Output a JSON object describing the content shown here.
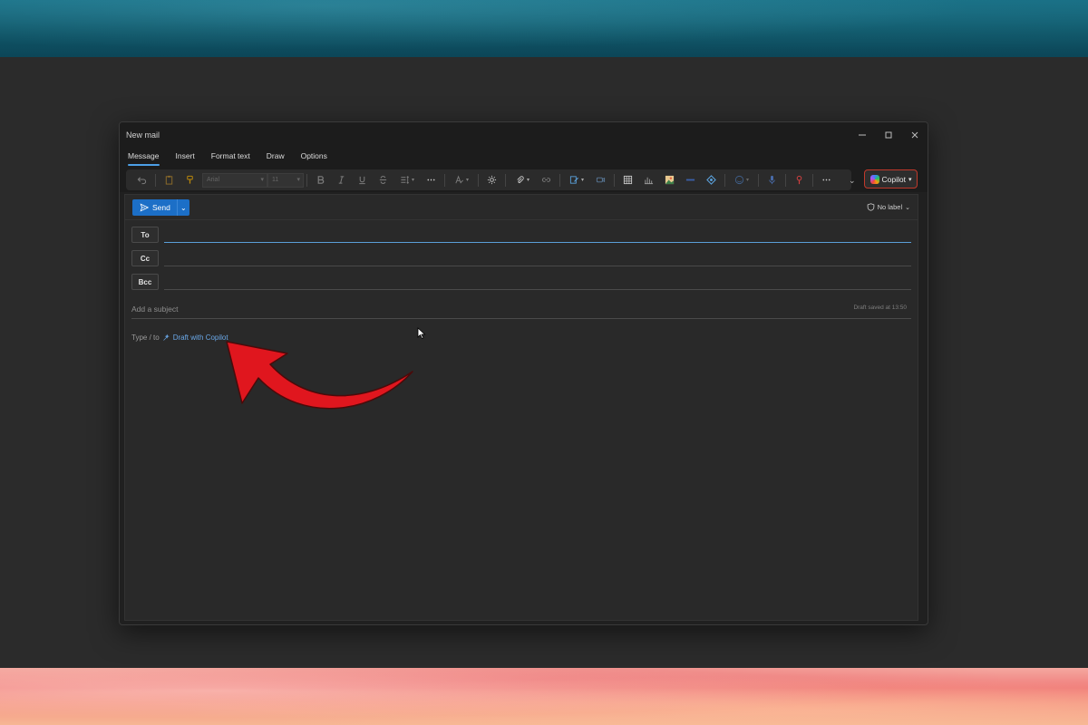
{
  "window": {
    "title": "New mail"
  },
  "tabs": [
    {
      "label": "Message",
      "active": true
    },
    {
      "label": "Insert",
      "active": false
    },
    {
      "label": "Format text",
      "active": false
    },
    {
      "label": "Draw",
      "active": false
    },
    {
      "label": "Options",
      "active": false
    }
  ],
  "ribbon": {
    "font_name": "Arial",
    "font_size": "11",
    "copilot_label": "Copilot"
  },
  "compose": {
    "send_label": "Send",
    "label_button": "No label",
    "recipients": {
      "to": "To",
      "cc": "Cc",
      "bcc": "Bcc"
    },
    "subject_placeholder": "Add a subject",
    "draft_status": "Draft saved at 13:50",
    "body_hint_prefix": "Type / to",
    "body_hint_link": "Draft with Copilot"
  },
  "colors": {
    "accent": "#1c6fc7",
    "focus_underline": "#5a9fd8",
    "copilot_border": "#c0392b",
    "annotation_arrow": "#e0161e"
  },
  "icons": [
    "undo-icon",
    "clipboard-icon",
    "format-painter-icon",
    "bold-icon",
    "italic-icon",
    "underline-icon",
    "strikethrough-icon",
    "spacing-icon",
    "more-icon",
    "styles-icon",
    "brightness-icon",
    "attach-icon",
    "link-icon",
    "signature-icon",
    "meeting-icon",
    "table-icon",
    "chart-icon",
    "image-icon",
    "line-icon",
    "loop-icon",
    "emoji-icon",
    "dictate-icon",
    "sensitivity-icon",
    "copilot-icon"
  ]
}
